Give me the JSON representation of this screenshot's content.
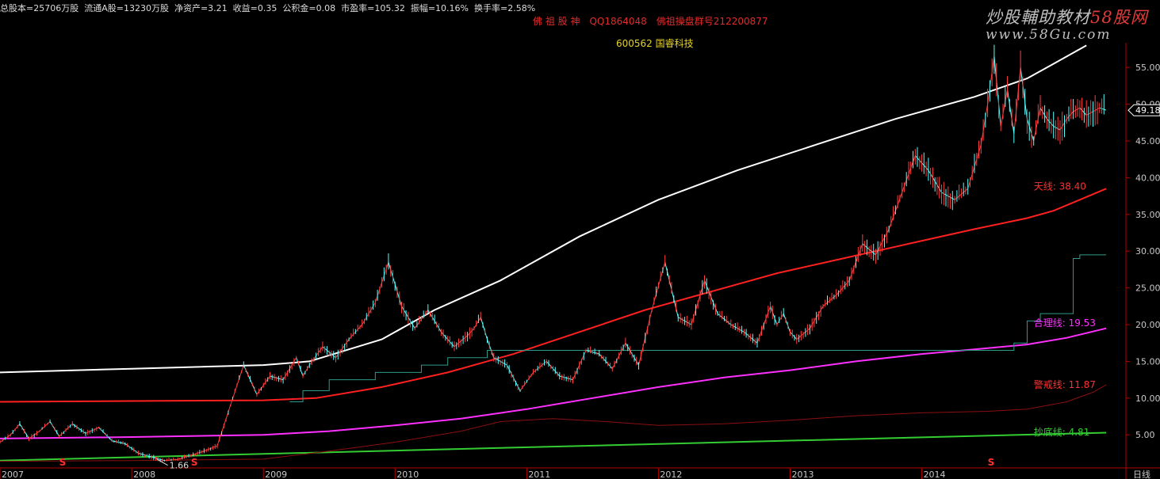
{
  "header": {
    "info": [
      "总股本=25706万股",
      "流通A股=13230万股",
      "净资产=3.21",
      "收益=0.35",
      "公积金=0.08",
      "市盈率=105.32",
      "振幅=10.16%",
      "换手率=2.58%"
    ],
    "brand": [
      "佛 祖 股 神",
      "QQ1864048",
      "佛祖操盘群号212200877"
    ],
    "stock": "600562 国睿科技"
  },
  "watermark": {
    "text": "炒股輔助教材",
    "brand": "58股网",
    "url": "www.58Gu.com"
  },
  "colors": {
    "background": "#000000",
    "axis": "#b40000",
    "up_candle": "#ff3c3c",
    "down_candle": "#54ffff",
    "white_line": "#ffffff",
    "red_line": "#ff2020",
    "magenta_line": "#ff30ff",
    "green_line": "#33cc33",
    "dark_red_line": "#8a1010",
    "teal_line": "#2f9a8a"
  },
  "chart_data": {
    "type": "line",
    "period_label": "日线",
    "x_ticks": [
      "2007",
      "2008",
      "2009",
      "2010",
      "2011",
      "2012",
      "2013",
      "2014"
    ],
    "y_ticks": [
      5.0,
      10.0,
      15.0,
      20.0,
      25.0,
      30.0,
      35.0,
      40.0,
      45.0,
      50.0,
      55.0
    ],
    "y_tick_labels": [
      "5.00",
      "10.00",
      "15.00",
      "20.00",
      "25.00",
      "30.00",
      "35.00",
      "40.00",
      "45.00",
      "50.00",
      "55.00"
    ],
    "ylim": [
      0.5,
      57.5
    ],
    "xlim": [
      2007.0,
      2015.55
    ],
    "price_series": {
      "name": "price",
      "x": [
        2007.0,
        2007.08,
        2007.15,
        2007.22,
        2007.3,
        2007.38,
        2007.45,
        2007.55,
        2007.65,
        2007.75,
        2007.85,
        2007.95,
        2008.05,
        2008.15,
        2008.25,
        2008.35,
        2008.45,
        2008.55,
        2008.65,
        2008.75,
        2008.85,
        2008.95,
        2009.05,
        2009.15,
        2009.25,
        2009.3,
        2009.35,
        2009.45,
        2009.55,
        2009.65,
        2009.75,
        2009.85,
        2009.95,
        2010.05,
        2010.15,
        2010.25,
        2010.35,
        2010.45,
        2010.55,
        2010.6,
        2010.65,
        2010.7,
        2010.75,
        2010.85,
        2010.95,
        2011.05,
        2011.15,
        2011.25,
        2011.35,
        2011.45,
        2011.55,
        2011.65,
        2011.75,
        2011.85,
        2011.95,
        2012.05,
        2012.15,
        2012.25,
        2012.35,
        2012.45,
        2012.55,
        2012.65,
        2012.75,
        2012.85,
        2012.9,
        2012.95,
        2013.0,
        2013.05,
        2013.15,
        2013.25,
        2013.35,
        2013.45,
        2013.55,
        2013.65,
        2013.75,
        2013.85,
        2013.95,
        2014.05,
        2014.15,
        2014.25,
        2014.35,
        2014.45,
        2014.5,
        2014.55,
        2014.6,
        2014.65,
        2014.7,
        2014.75,
        2014.8,
        2014.85,
        2014.9,
        2014.95,
        2015.0,
        2015.05,
        2015.1,
        2015.15,
        2015.2,
        2015.25,
        2015.3,
        2015.35,
        2015.4
      ],
      "y": [
        4.0,
        5.0,
        6.5,
        4.5,
        5.5,
        6.8,
        4.8,
        6.5,
        5.2,
        6.0,
        4.2,
        3.8,
        2.5,
        2.0,
        1.5,
        1.66,
        2.2,
        2.8,
        3.5,
        9.0,
        14.5,
        10.5,
        13.0,
        12.5,
        15.5,
        13.0,
        14.5,
        17.0,
        15.5,
        18.0,
        20.0,
        23.0,
        28.5,
        22.5,
        19.5,
        22.0,
        19.0,
        17.0,
        18.5,
        19.5,
        21.0,
        18.0,
        15.5,
        14.5,
        11.0,
        13.5,
        15.0,
        13.0,
        12.5,
        16.5,
        16.0,
        14.0,
        17.5,
        14.5,
        22.0,
        28.5,
        21.0,
        20.0,
        26.0,
        21.5,
        20.0,
        19.0,
        17.5,
        22.5,
        20.0,
        21.5,
        19.0,
        18.0,
        19.5,
        22.5,
        24.0,
        26.0,
        31.0,
        29.5,
        33.0,
        38.0,
        43.0,
        41.0,
        38.0,
        37.0,
        38.5,
        44.5,
        50.0,
        56.5,
        47.0,
        52.0,
        46.0,
        55.0,
        48.0,
        45.0,
        49.5,
        48.0,
        47.0,
        46.5,
        48.0,
        49.0,
        49.5,
        48.5,
        49.0,
        49.5,
        49.18
      ],
      "low_label": "1.66",
      "current_label": "49.18"
    },
    "series": [
      {
        "name": "white",
        "x": [
          2007.0,
          2008.0,
          2009.0,
          2009.35,
          2009.9,
          2010.3,
          2010.8,
          2011.4,
          2012.0,
          2012.6,
          2013.2,
          2013.8,
          2014.4,
          2014.8,
          2015.0,
          2015.25
        ],
        "y": [
          13.5,
          14.0,
          14.5,
          15.0,
          18.0,
          22.0,
          26.0,
          32.0,
          37.0,
          41.0,
          44.5,
          48.0,
          51.0,
          53.5,
          55.5,
          58.0
        ]
      },
      {
        "name": "red",
        "x": [
          2007.0,
          2008.0,
          2009.0,
          2009.4,
          2009.9,
          2010.4,
          2010.9,
          2011.4,
          2011.9,
          2012.4,
          2012.9,
          2013.4,
          2013.9,
          2014.4,
          2014.8,
          2015.0,
          2015.2,
          2015.4
        ],
        "y": [
          9.5,
          9.6,
          9.7,
          10.0,
          11.5,
          13.5,
          16.0,
          19.0,
          22.0,
          24.5,
          27.0,
          29.0,
          31.0,
          33.0,
          34.5,
          35.5,
          37.0,
          38.5
        ]
      },
      {
        "name": "magenta",
        "x": [
          2007.0,
          2008.0,
          2009.0,
          2009.5,
          2010.0,
          2010.5,
          2011.0,
          2011.5,
          2012.0,
          2012.5,
          2013.0,
          2013.5,
          2014.0,
          2014.5,
          2014.8,
          2015.1,
          2015.4
        ],
        "y": [
          4.5,
          4.7,
          5.0,
          5.5,
          6.3,
          7.2,
          8.5,
          10.0,
          11.5,
          12.8,
          13.8,
          15.0,
          16.0,
          16.8,
          17.3,
          18.2,
          19.5
        ]
      },
      {
        "name": "green",
        "x": [
          2007.0,
          2015.4
        ],
        "y": [
          1.5,
          5.3
        ]
      },
      {
        "name": "dark-red",
        "x": [
          2007.0,
          2008.0,
          2009.0,
          2009.5,
          2010.0,
          2010.5,
          2010.8,
          2011.2,
          2011.6,
          2012.0,
          2012.5,
          2013.0,
          2013.5,
          2014.0,
          2014.5,
          2014.8,
          2015.1,
          2015.3,
          2015.4
        ],
        "y": [
          1.4,
          1.5,
          1.7,
          2.8,
          4.0,
          5.5,
          6.8,
          7.2,
          6.8,
          6.3,
          6.5,
          7.0,
          7.6,
          8.0,
          8.2,
          8.5,
          9.5,
          10.8,
          11.8
        ]
      },
      {
        "name": "teal-step",
        "x": [
          2009.2,
          2009.3,
          2009.5,
          2009.8,
          2009.85,
          2010.15,
          2010.2,
          2010.35,
          2010.4,
          2010.65,
          2010.7,
          2014.6,
          2014.7,
          2014.8,
          2014.9,
          2015.05,
          2015.15,
          2015.2,
          2015.4
        ],
        "y": [
          9.5,
          11.0,
          12.5,
          12.5,
          13.5,
          13.5,
          14.5,
          14.5,
          15.5,
          15.5,
          16.5,
          16.5,
          17.5,
          20.5,
          21.5,
          21.5,
          29.0,
          29.5,
          29.5
        ]
      }
    ],
    "annotations": [
      {
        "text": "合理线: 19.53",
        "color": "#ff30ff",
        "x": 2014.85,
        "y": 19.8
      },
      {
        "text": "警戒线: 11.87",
        "color": "#ff3030",
        "x": 2014.85,
        "y": 11.4
      },
      {
        "text": "抄底线: 4.81",
        "color": "#33cc33",
        "x": 2014.85,
        "y": 4.9
      },
      {
        "text": "天线: 38.40",
        "color": "#ff3030",
        "x": 2014.85,
        "y": 38.4
      }
    ],
    "signals": [
      {
        "text": "S",
        "x": 2007.45
      },
      {
        "text": "S",
        "x": 2008.45
      },
      {
        "text": "S",
        "x": 2014.5
      }
    ]
  }
}
